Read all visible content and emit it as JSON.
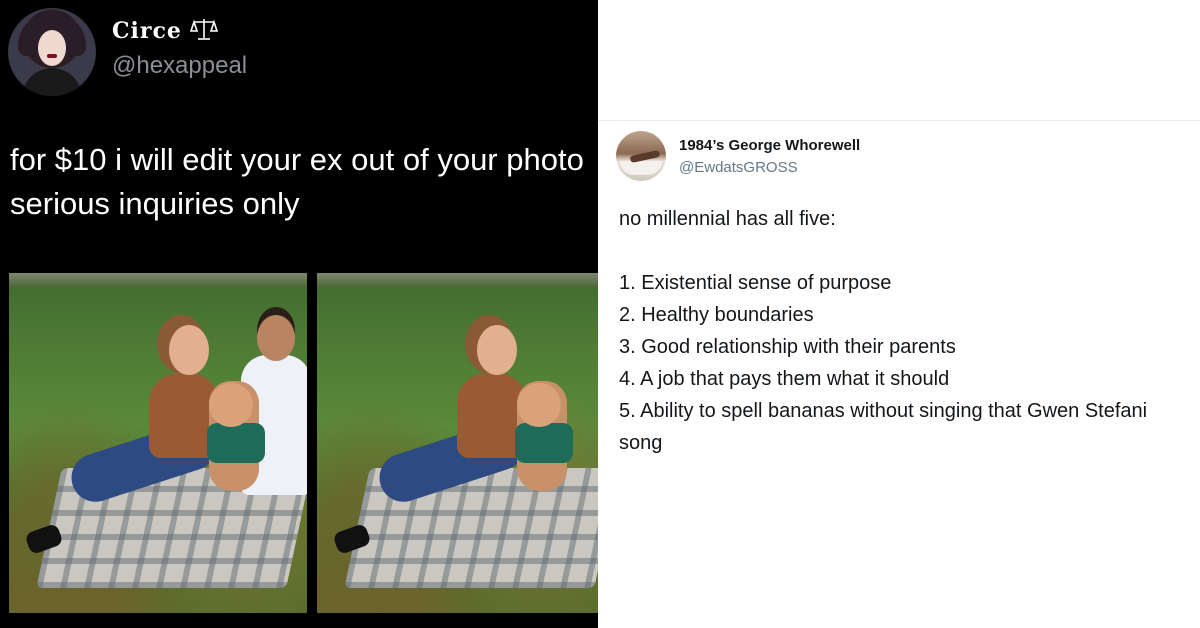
{
  "left_tweet": {
    "name": "Circe",
    "name_icon": "scales-icon",
    "handle": "@hexappeal",
    "text": "for $10 i will edit your ex out of your photo serious inquiries only",
    "photos": [
      "before-photo",
      "after-photo"
    ]
  },
  "right_tweet": {
    "name": "1984’s George Whorewell",
    "handle": "@EwdatsGROSS",
    "intro": "no millennial has all five:",
    "items": [
      "1. Existential sense of purpose",
      "2. Healthy boundaries",
      "3. Good relationship with their parents",
      "4. A job that pays them what it should",
      "5. Ability to spell bananas without singing that Gwen Stefani song"
    ]
  },
  "colors": {
    "left_bg": "#000000",
    "right_bg": "#ffffff",
    "handle_dark": "#8b8f95",
    "handle_light": "#657786"
  }
}
